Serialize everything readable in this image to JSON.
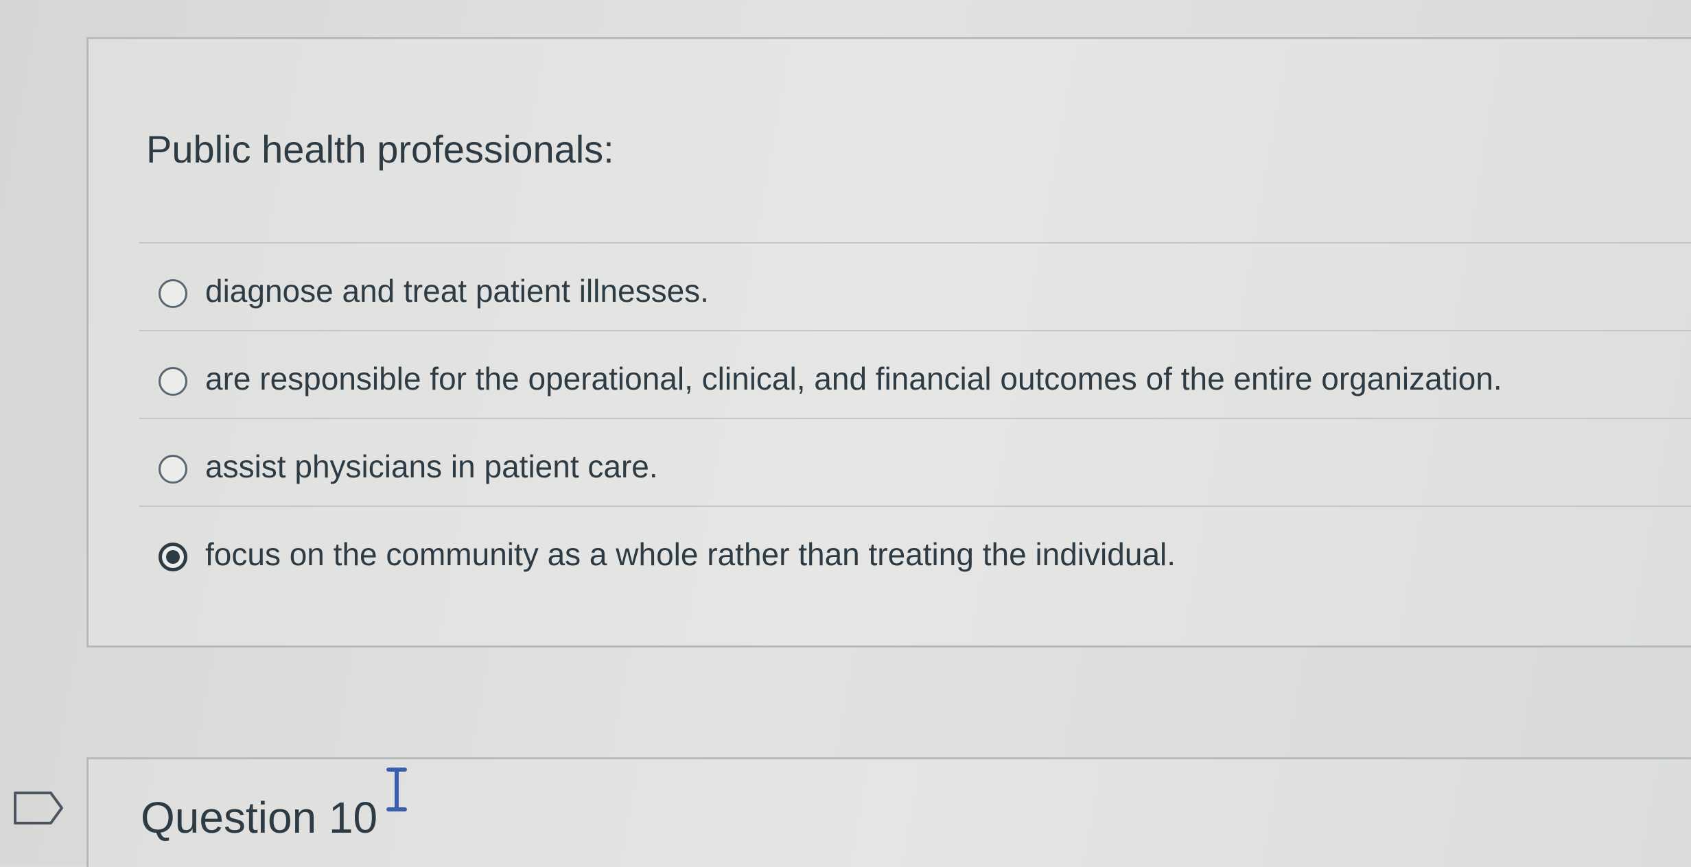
{
  "question": {
    "text": "Public health professionals:",
    "answers": [
      {
        "label": "diagnose and treat patient illnesses.",
        "selected": false
      },
      {
        "label": "are responsible for the operational, clinical, and financial outcomes of the entire organization.",
        "selected": false
      },
      {
        "label": "assist physicians in patient care.",
        "selected": false
      },
      {
        "label": "focus on the community as a whole rather than treating the individual.",
        "selected": true
      }
    ]
  },
  "next_question": {
    "title": "Question 10"
  },
  "icons": {
    "flag": "flag-outline-icon",
    "cursor": "text-cursor-icon"
  },
  "colors": {
    "text": "#2d3b45",
    "border": "#b8bbbc",
    "cursor": "#3a5fb0"
  }
}
